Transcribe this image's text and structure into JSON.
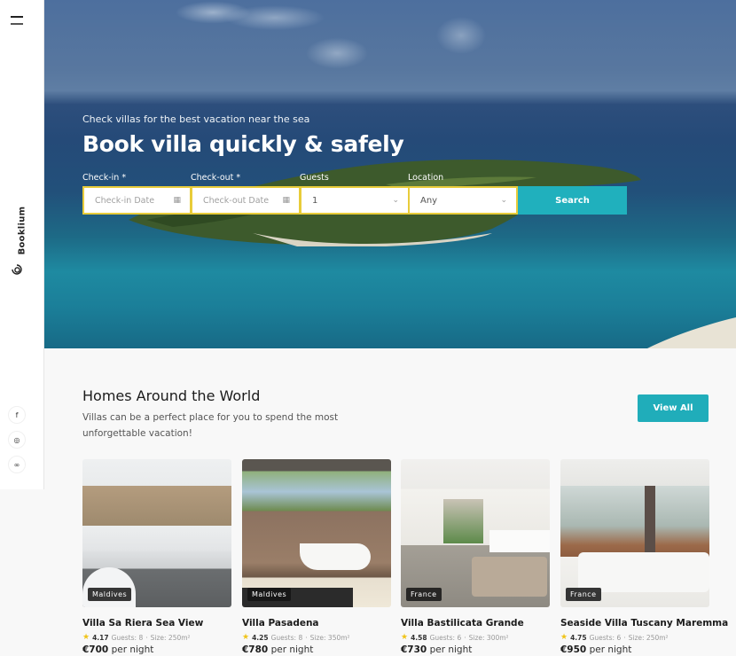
{
  "sidebar": {
    "brand": "Booklium",
    "social": [
      {
        "icon": "facebook-icon",
        "glyph": "f"
      },
      {
        "icon": "instagram-icon",
        "glyph": "◎"
      },
      {
        "icon": "tripadvisor-icon",
        "glyph": "∞"
      }
    ]
  },
  "hero": {
    "subtitle": "Check villas for the best vacation near the sea",
    "title": "Book villa quickly & safely",
    "form": {
      "checkin": {
        "label": "Check-in *",
        "placeholder": "Check-in Date"
      },
      "checkout": {
        "label": "Check-out *",
        "placeholder": "Check-out Date"
      },
      "guests": {
        "label": "Guests",
        "value": "1"
      },
      "location": {
        "label": "Location",
        "value": "Any"
      },
      "search_label": "Search"
    }
  },
  "section": {
    "title": "Homes Around the World",
    "description": "Villas can be a perfect place for you to spend the most unforgettable vacation!",
    "view_all_label": "View All"
  },
  "listings": [
    {
      "name": "Villa Sa Riera Sea View",
      "location": "Maldives",
      "rating": "4.17",
      "guests": "Guests: 8",
      "size": "Size: 250m²",
      "price": "€700",
      "price_unit": "per night"
    },
    {
      "name": "Villa Pasadena",
      "location": "Maldives",
      "rating": "4.25",
      "guests": "Guests: 8",
      "size": "Size: 350m²",
      "price": "€780",
      "price_unit": "per night"
    },
    {
      "name": "Villa Bastilicata Grande",
      "location": "France",
      "rating": "4.58",
      "guests": "Guests: 6",
      "size": "Size: 300m²",
      "price": "€730",
      "price_unit": "per night"
    },
    {
      "name": "Seaside Villa Tuscany Maremma",
      "location": "France",
      "rating": "4.75",
      "guests": "Guests: 6",
      "size": "Size: 250m²",
      "price": "€950",
      "price_unit": "per night"
    }
  ],
  "colors": {
    "accent": "#20b0bd",
    "field_border": "#e8cc3a",
    "star": "#f0c419"
  }
}
